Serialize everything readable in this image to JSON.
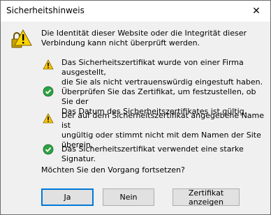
{
  "titlebar": {
    "title": "Sicherheitshinweis",
    "close_glyph": "✕"
  },
  "intro": "Die Identität dieser Website oder die Integrität dieser Verbindung kann nicht überprüft werden.",
  "messages": [
    {
      "icon": "warning-icon",
      "lines": [
        "Das Sicherheitszertifikat wurde von einer Firma ausgestellt,",
        "die Sie als nicht vertrauenswürdig eingestuft haben.",
        "Überprüfen Sie das Zertifikat, um festzustellen, ob Sie der",
        "Das Datum des Sicherheitszertifikates ist gültig."
      ]
    },
    {
      "icon": "warning-icon",
      "lines": [
        "Der auf dem Sicherheitszertifikat angegebene Name ist",
        "ungültig oder stimmt nicht mit dem Namen der Site überein."
      ]
    },
    {
      "icon": "check-icon",
      "lines": [
        "Das Sicherheitszertifikat verwendet eine starke Signatur."
      ]
    }
  ],
  "question": "Möchten Sie den Vorgang fortsetzen?",
  "buttons": {
    "yes": "Ja",
    "no": "Nein",
    "view_certificate": "Zertifikat anzeigen"
  },
  "colors": {
    "warning": "#f5c400",
    "success": "#2ea043",
    "accent": "#0078d7"
  }
}
